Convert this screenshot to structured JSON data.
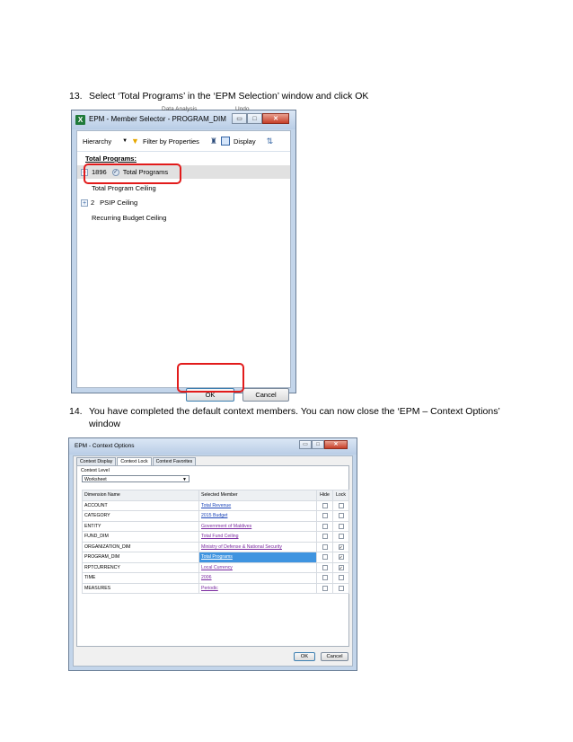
{
  "step13": {
    "number": "13.",
    "text": "Select ‘Total Programs’ in the ‘EPM Selection’ window and click OK"
  },
  "step14": {
    "number": "14.",
    "line1": "You have completed the default context members. You can now close the ‘EPM – Context Options’",
    "line2": "window"
  },
  "member_selector": {
    "peek_left": "Data Analysis",
    "peek_right": "Undo",
    "title": "EPM - Member Selector - PROGRAM_DIM",
    "excel_icon": "excel-icon",
    "toolbar": {
      "hierarchy": "Hierarchy",
      "filter": "Filter by Properties",
      "display": "Display"
    },
    "tree_header": "Total Programs:",
    "rows": {
      "r1_code": "1896",
      "r1_label": "Total Programs",
      "r2_label": "Total Program Ceiling",
      "r3_code": "2",
      "r3_label": "PSIP Ceiling",
      "r4_label": "Recurring Budget Ceiling"
    },
    "ok_label": "OK",
    "cancel_label": "Cancel",
    "highlight_color": "#e21b1b"
  },
  "context_options": {
    "title": "EPM - Context Options",
    "tabs": [
      "Context Display",
      "Context Lock",
      "Context Favorites"
    ],
    "context_level_label": "Context Level",
    "context_level_value": "Worksheet",
    "columns": {
      "dimension": "Dimension Name",
      "member": "Selected Member",
      "hide": "Hide",
      "lock": "Lock"
    },
    "rows": [
      {
        "dimension": "ACCOUNT",
        "member": "Total Revenue",
        "hide": false,
        "lock": false
      },
      {
        "dimension": "CATEGORY",
        "member": "2015 Budget",
        "hide": false,
        "lock": false
      },
      {
        "dimension": "ENTITY",
        "member": "Government of Maldives",
        "hide": false,
        "lock": false
      },
      {
        "dimension": "FUND_DIM",
        "member": "Total Fund Ceiling",
        "hide": false,
        "lock": false
      },
      {
        "dimension": "ORGANIZATION_DIM",
        "member": "Ministry of Defense & National Security",
        "hide": false,
        "lock": true
      },
      {
        "dimension": "PROGRAM_DIM",
        "member": "Total Programs",
        "hide": false,
        "lock": true
      },
      {
        "dimension": "RPTCURRENCY",
        "member": "Local Currency",
        "hide": false,
        "lock": true
      },
      {
        "dimension": "TIME",
        "member": "2006",
        "hide": false,
        "lock": false
      },
      {
        "dimension": "MEASURES",
        "member": "Periodic",
        "hide": false,
        "lock": false
      }
    ],
    "ok_label": "OK",
    "cancel_label": "Cancel"
  }
}
